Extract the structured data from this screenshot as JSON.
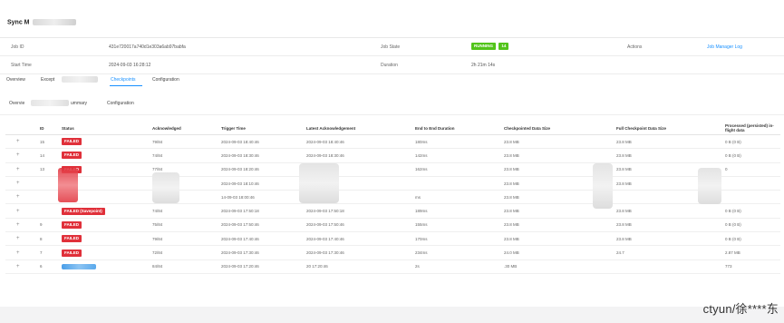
{
  "job": {
    "title": "Sync M",
    "job_id_label": "Job ID",
    "job_id_value": "431e720017a740d1e303a6ab97babfa",
    "start_time_label": "Start Time",
    "start_time_value": "2024-09-03 16:28:12",
    "job_state_label": "Job State",
    "job_state_value": "RUNNING",
    "job_state_count": "14",
    "duration_label": "Duration",
    "duration_value": "2h 21m 14s",
    "actions_label": "Actions",
    "actions_link": "Job Manager Log"
  },
  "tabs": [
    "Overview",
    "Except",
    "Checkpoints",
    "Configuration"
  ],
  "active_tab": "Checkpoints",
  "subtabs": [
    "Overvie",
    "ummary",
    "Configuration"
  ],
  "table": {
    "headers": [
      "ID",
      "Status",
      "Acknowledged",
      "Trigger Time",
      "Latest Acknowledgement",
      "End to End Duration",
      "Checkpointed Data Size",
      "Full Checkpoint Data Size",
      "Processed (persisted) in-flight data"
    ],
    "rows": [
      {
        "plus": "+",
        "id": "15",
        "status": "FAILED",
        "ack": "79/84",
        "trigger": "2024-09-03 18:40:46",
        "latest": "2024-09-03 18:40:46",
        "e2e": "180ms",
        "cp": "23.8 MB",
        "full": "23.8 MB",
        "inflight": "0 B (0 B)"
      },
      {
        "plus": "+",
        "id": "14",
        "status": "FAILED",
        "ack": "74/84",
        "trigger": "2024-09-03 18:30:46",
        "latest": "2024-09-03 18:30:46",
        "e2e": "142ms",
        "cp": "23.8 MB",
        "full": "23.8 MB",
        "inflight": "0 B (0 B)"
      },
      {
        "plus": "+",
        "id": "13",
        "status": "FAILED",
        "ack": "77/84",
        "trigger": "2024-09-03 18:20:46",
        "latest": "2024-09-03 1",
        "e2e": "162ms",
        "cp": "23.8 MB",
        "full": "23.8 MB",
        "inflight": "0 "
      },
      {
        "plus": "+",
        "id": "",
        "status": "",
        "ack": "7",
        "trigger": "2024-09-03 18:10:46",
        "latest": "",
        "e2e": "",
        "cp": "23.8 MB",
        "full": "23.8 MB",
        "inflight": ""
      },
      {
        "plus": "+",
        "id": "",
        "status": "",
        "ack": "",
        "trigger": "14-09-03 18:00:46",
        "latest": "",
        "e2e": "ms",
        "cp": "23.8 MB",
        "full": "",
        "inflight": ""
      },
      {
        "plus": "+",
        "id": "",
        "status": "FAILED (Savepoint)",
        "ack": "74/84",
        "trigger": "2024-09-03 17:50:18",
        "latest": "2024-09-03 17:50:18",
        "e2e": "189ms",
        "cp": "23.8 MB",
        "full": "23.8 MB",
        "inflight": "0 B (0 B)"
      },
      {
        "plus": "+",
        "id": "9",
        "status": "FAILED",
        "ack": "75/84",
        "trigger": "2024-09-03 17:50:46",
        "latest": "2024-09-03 17:50:46",
        "e2e": "155ms",
        "cp": "23.8 MB",
        "full": "23.8 MB",
        "inflight": "0 B (0 B)"
      },
      {
        "plus": "+",
        "id": "8",
        "status": "FAILED",
        "ack": "79/84",
        "trigger": "2024-09-03 17:40:46",
        "latest": "2024-09-03 17:40:46",
        "e2e": "170ms",
        "cp": "23.8 MB",
        "full": "23.8 MB",
        "inflight": "0 B (0 B)"
      },
      {
        "plus": "+",
        "id": "7",
        "status": "FAILED",
        "ack": "72/84",
        "trigger": "2024-09-03 17:30:46",
        "latest": "2024-09-03 17:30:46",
        "e2e": "234ms",
        "cp": "24.0 MB",
        "full": "24.7",
        "inflight": "2.87 MB"
      },
      {
        "plus": "+",
        "id": "6",
        "status": "",
        "ack": "84/84",
        "trigger": "2024-09-03 17:20:46",
        "latest": "20 17:20:46",
        "e2e": "2s",
        "cp": ".30 MB",
        "full": "",
        "inflight": "773"
      }
    ]
  },
  "watermark": "ctyun/徐****东",
  "colors": {
    "running": "#52c41a",
    "failed": "#e0303a",
    "link": "#1890ff"
  }
}
